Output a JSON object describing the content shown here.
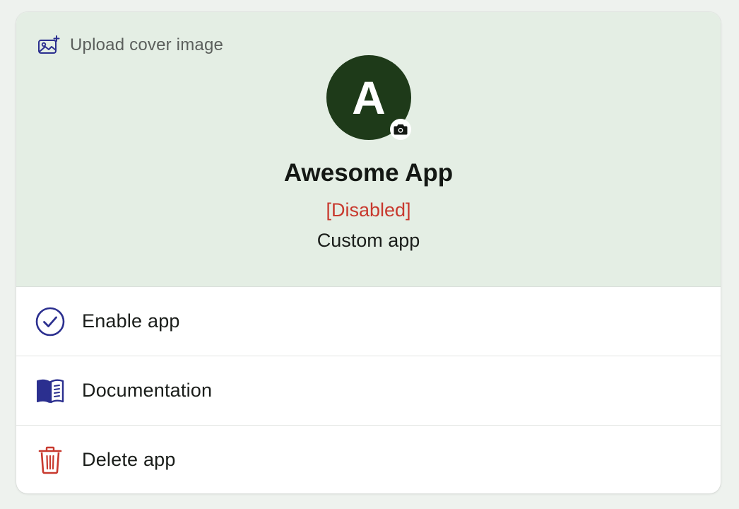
{
  "cover": {
    "upload_label": "Upload cover image",
    "avatar_letter": "A",
    "avatar_color": "#1e3a19",
    "background_color": "#e4eee4",
    "app_name": "Awesome App",
    "status": "[Disabled]",
    "status_color": "#c8392e",
    "app_type": "Custom app"
  },
  "menu": {
    "items": [
      {
        "label": "Enable app",
        "icon": "check-circle-icon",
        "icon_color": "#2b2f8f"
      },
      {
        "label": "Documentation",
        "icon": "book-icon",
        "icon_color": "#2b2f8f"
      },
      {
        "label": "Delete app",
        "icon": "trash-icon",
        "icon_color": "#c8392e"
      }
    ]
  }
}
